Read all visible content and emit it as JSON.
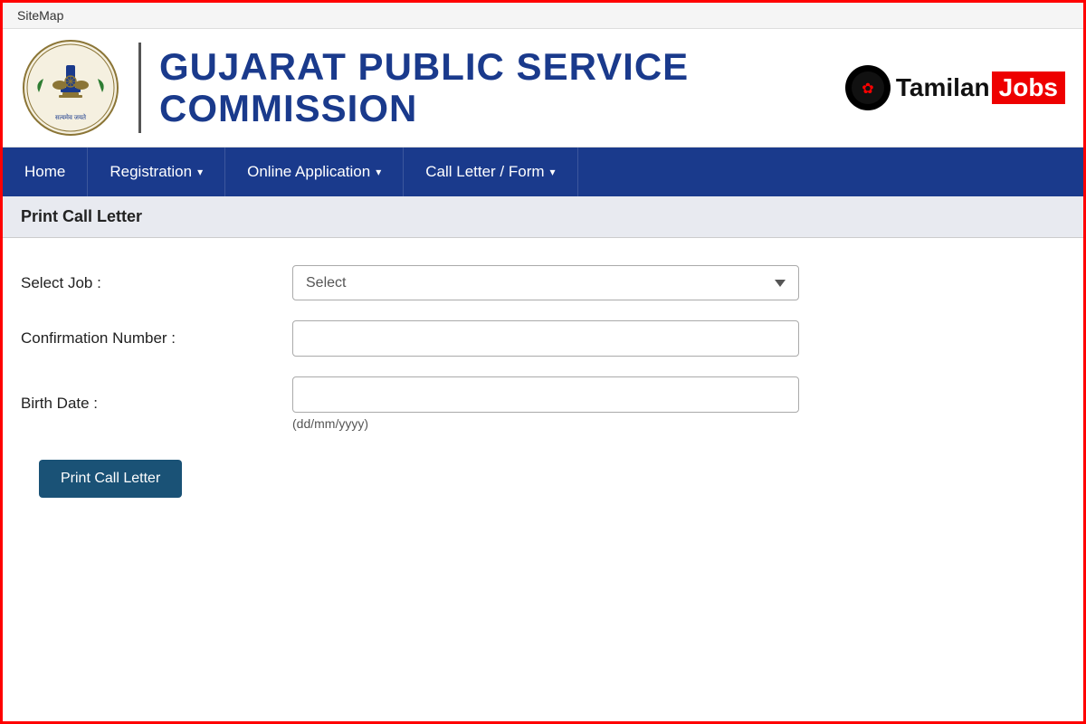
{
  "topbar": {
    "sitemap_label": "SiteMap"
  },
  "header": {
    "title": "GUJARAT PUBLIC SERVICE COMMISSION",
    "watermark": {
      "tamilan": "Tamilan",
      "jobs": "Jobs"
    }
  },
  "navbar": {
    "items": [
      {
        "label": "Home",
        "has_dropdown": false
      },
      {
        "label": "Registration",
        "has_dropdown": true
      },
      {
        "label": "Online Application",
        "has_dropdown": true
      },
      {
        "label": "Call Letter / Form",
        "has_dropdown": true
      }
    ]
  },
  "page": {
    "section_title": "Print Call Letter",
    "form": {
      "select_job_label": "Select Job :",
      "select_job_placeholder": "Select",
      "confirmation_number_label": "Confirmation Number :",
      "birth_date_label": "Birth Date :",
      "birth_date_hint": "(dd/mm/yyyy)",
      "print_button_label": "Print Call Letter"
    }
  }
}
